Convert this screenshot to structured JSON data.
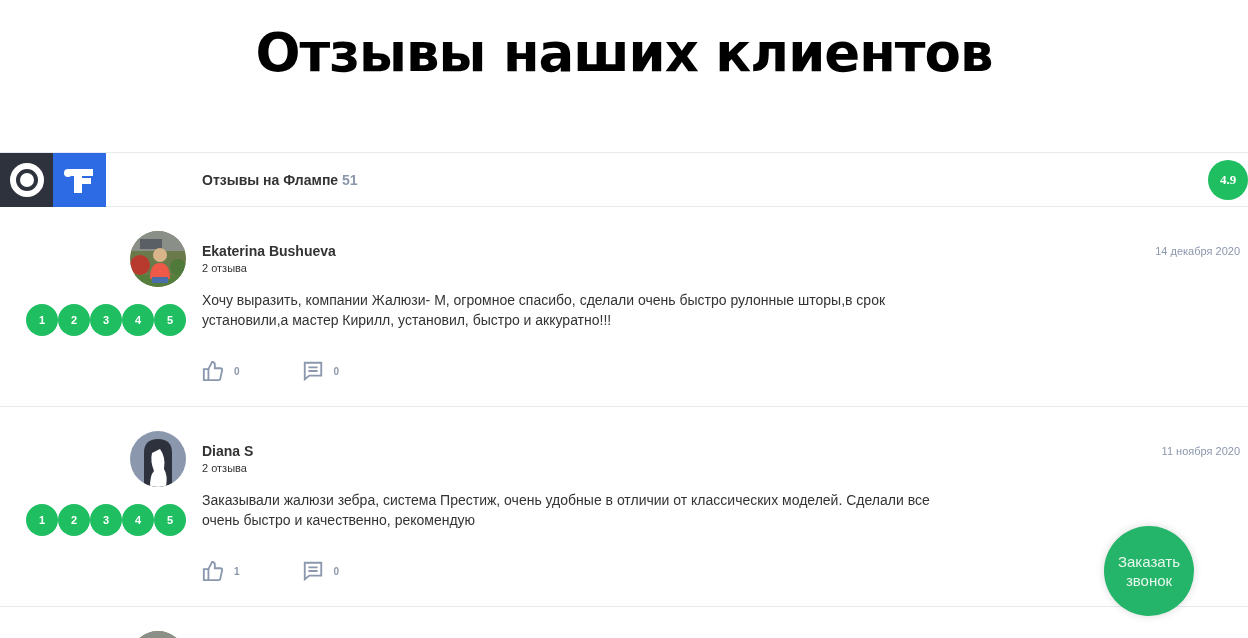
{
  "heading": "Отзывы наших клиентов",
  "source_bar": {
    "label": "Отзывы на Флампе",
    "count": "51",
    "score": "4.9"
  },
  "reviews": [
    {
      "name": "Ekaterina Bushueva",
      "review_count": "2 отзыва",
      "date": "14 декабря 2020",
      "rating_points": [
        {
          "label": "1",
          "filled": true
        },
        {
          "label": "2",
          "filled": true
        },
        {
          "label": "3",
          "filled": true
        },
        {
          "label": "4",
          "filled": true
        },
        {
          "label": "5",
          "filled": true
        }
      ],
      "text": "Хочу выразить, компании Жалюзи- М, огромное спасибо, сделали очень быстро рулонные шторы,в срок установили,а мастер Кирилл, установил, быстро и аккуратно!!!",
      "likes": "0",
      "comments": "0"
    },
    {
      "name": "Diana S",
      "review_count": "2 отзыва",
      "date": "11 ноября 2020",
      "avatar": {
        "kind": "silhouette"
      },
      "rating_points": [
        {
          "label": "1",
          "filled": true
        },
        {
          "label": "2",
          "filled": true
        },
        {
          "label": "3",
          "filled": true
        },
        {
          "label": "4",
          "filled": true
        },
        {
          "label": "5",
          "filled": true
        }
      ],
      "text": "Заказывали жалюзи зебра, система Престиж, очень удобные в отличии от классических моделей. Сделали все очень быстро и качественно, рекомендую",
      "likes": "1",
      "comments": "0"
    }
  ],
  "callback_button": {
    "label": "Заказать звонок"
  }
}
